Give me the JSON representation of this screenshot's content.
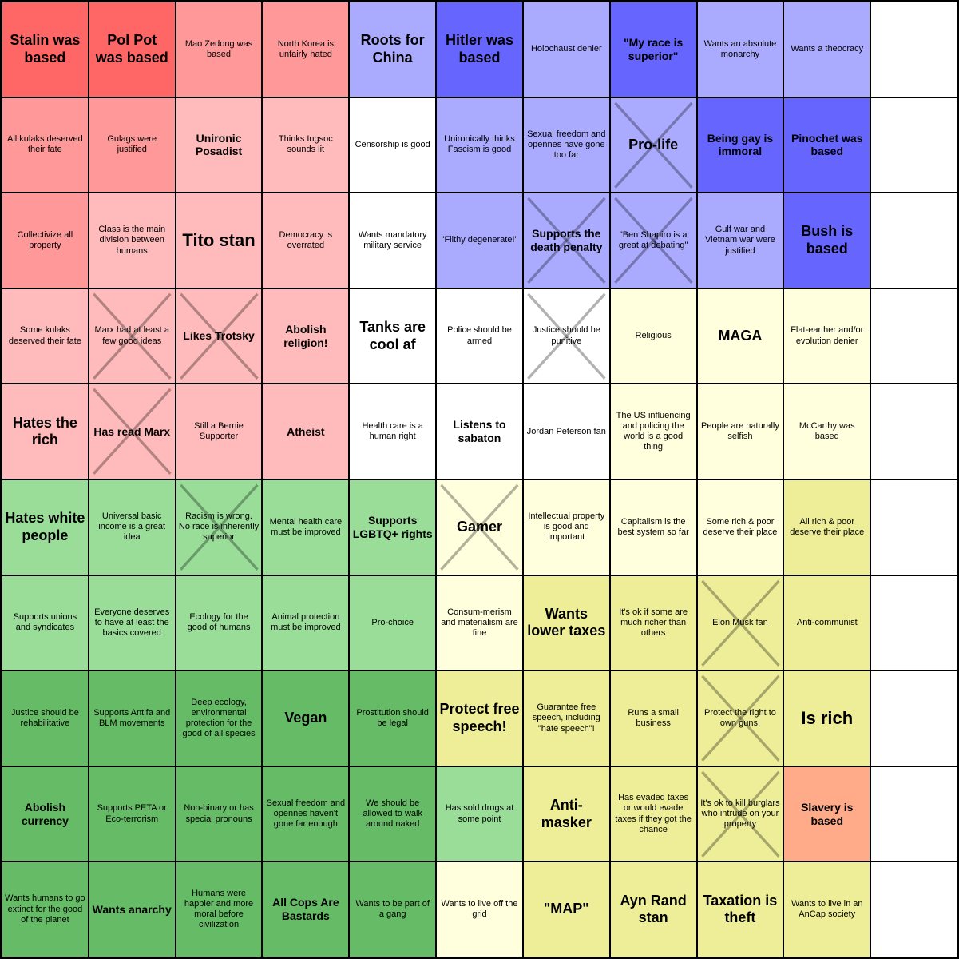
{
  "cells": [
    {
      "text": "Stalin was based",
      "color": "red",
      "size": "large",
      "x": false,
      "col": 1,
      "row": 1
    },
    {
      "text": "Pol Pot was based",
      "color": "red",
      "size": "large",
      "x": false,
      "col": 2,
      "row": 1
    },
    {
      "text": "Mao Zedong was based",
      "color": "pink",
      "size": "small",
      "x": false,
      "col": 3,
      "row": 1
    },
    {
      "text": "North Korea is unfairly hated",
      "color": "pink",
      "size": "small",
      "x": false,
      "col": 4,
      "row": 1
    },
    {
      "text": "Roots for China",
      "color": "light-blue",
      "size": "large",
      "x": false,
      "col": 5,
      "row": 1
    },
    {
      "text": "Hitler was based",
      "color": "blue",
      "size": "large",
      "x": false,
      "col": 6,
      "row": 1
    },
    {
      "text": "Holochaust denier",
      "color": "light-blue",
      "size": "small",
      "x": false,
      "col": 7,
      "row": 1
    },
    {
      "text": "\"My race is superior\"",
      "color": "blue",
      "size": "medium",
      "x": false,
      "col": 8,
      "row": 1
    },
    {
      "text": "Wants an absolute monarchy",
      "color": "light-blue",
      "size": "small",
      "x": false,
      "col": 9,
      "row": 1
    },
    {
      "text": "Wants a theocracy",
      "color": "light-blue",
      "size": "small",
      "x": false,
      "col": 10,
      "row": 1
    },
    {
      "text": "",
      "color": "white",
      "size": "small",
      "x": false,
      "col": 11,
      "row": 1
    },
    {
      "text": "All kulaks deserved their fate",
      "color": "pink",
      "size": "small",
      "x": false,
      "col": 1,
      "row": 2
    },
    {
      "text": "Gulags were justified",
      "color": "pink",
      "size": "small",
      "x": false,
      "col": 2,
      "row": 2
    },
    {
      "text": "Unironic Posadist",
      "color": "light-pink",
      "size": "medium",
      "x": false,
      "col": 3,
      "row": 2
    },
    {
      "text": "Thinks Ingsoc sounds lit",
      "color": "light-pink",
      "size": "small",
      "x": false,
      "col": 4,
      "row": 2
    },
    {
      "text": "Censorship is good",
      "color": "white",
      "size": "small",
      "x": false,
      "col": 5,
      "row": 2
    },
    {
      "text": "Unironically thinks Fascism is good",
      "color": "light-blue",
      "size": "small",
      "x": false,
      "col": 6,
      "row": 2
    },
    {
      "text": "Sexual freedom and opennes have gone too far",
      "color": "light-blue",
      "size": "small",
      "x": false,
      "col": 7,
      "row": 2
    },
    {
      "text": "Pro-life",
      "color": "light-blue",
      "size": "large",
      "x": true,
      "col": 8,
      "row": 2
    },
    {
      "text": "Being gay is immoral",
      "color": "blue",
      "size": "medium",
      "x": false,
      "col": 9,
      "row": 2
    },
    {
      "text": "Pinochet was based",
      "color": "blue",
      "size": "medium",
      "x": false,
      "col": 10,
      "row": 2
    },
    {
      "text": "",
      "color": "white",
      "size": "small",
      "x": false,
      "col": 11,
      "row": 2
    },
    {
      "text": "Collectivize all property",
      "color": "pink",
      "size": "small",
      "x": false,
      "col": 1,
      "row": 3
    },
    {
      "text": "Class is the main division between humans",
      "color": "light-pink",
      "size": "small",
      "x": false,
      "col": 2,
      "row": 3
    },
    {
      "text": "Tito stan",
      "color": "light-pink",
      "size": "xl",
      "x": false,
      "col": 3,
      "row": 3
    },
    {
      "text": "Democracy is overrated",
      "color": "light-pink",
      "size": "small",
      "x": false,
      "col": 4,
      "row": 3
    },
    {
      "text": "Wants mandatory military service",
      "color": "white",
      "size": "small",
      "x": false,
      "col": 5,
      "row": 3
    },
    {
      "text": "\"Filthy degenerate!\"",
      "color": "light-blue",
      "size": "small",
      "x": false,
      "col": 6,
      "row": 3
    },
    {
      "text": "Supports the death penalty",
      "color": "light-blue",
      "size": "medium",
      "x": true,
      "col": 7,
      "row": 3
    },
    {
      "text": "\"Ben Shapiro is a great at debating\"",
      "color": "light-blue",
      "size": "small",
      "x": true,
      "col": 8,
      "row": 3
    },
    {
      "text": "Gulf war and Vietnam war were justified",
      "color": "light-blue",
      "size": "small",
      "x": false,
      "col": 9,
      "row": 3
    },
    {
      "text": "Bush is based",
      "color": "blue",
      "size": "large",
      "x": false,
      "col": 10,
      "row": 3
    },
    {
      "text": "",
      "color": "white",
      "size": "small",
      "x": false,
      "col": 11,
      "row": 3
    },
    {
      "text": "Some kulaks deserved their fate",
      "color": "light-pink",
      "size": "small",
      "x": false,
      "col": 1,
      "row": 4
    },
    {
      "text": "Marx had at least a few good ideas",
      "color": "light-pink",
      "size": "small",
      "x": true,
      "col": 2,
      "row": 4
    },
    {
      "text": "Likes Trotsky",
      "color": "light-pink",
      "size": "medium",
      "x": true,
      "col": 3,
      "row": 4
    },
    {
      "text": "Abolish religion!",
      "color": "light-pink",
      "size": "medium",
      "x": false,
      "col": 4,
      "row": 4
    },
    {
      "text": "Tanks are cool af",
      "color": "white",
      "size": "large",
      "x": false,
      "col": 5,
      "row": 4
    },
    {
      "text": "Police should be armed",
      "color": "white",
      "size": "small",
      "x": false,
      "col": 6,
      "row": 4
    },
    {
      "text": "Justice should be punitive",
      "color": "white",
      "size": "small",
      "x": true,
      "col": 7,
      "row": 4
    },
    {
      "text": "Religious",
      "color": "light-yellow",
      "size": "small",
      "x": false,
      "col": 8,
      "row": 4
    },
    {
      "text": "MAGA",
      "color": "light-yellow",
      "size": "large",
      "x": false,
      "col": 9,
      "row": 4
    },
    {
      "text": "Flat-earther and/or evolution denier",
      "color": "light-yellow",
      "size": "small",
      "x": false,
      "col": 10,
      "row": 4
    },
    {
      "text": "",
      "color": "white",
      "size": "small",
      "x": false,
      "col": 11,
      "row": 4
    },
    {
      "text": "Hates the rich",
      "color": "light-pink",
      "size": "large",
      "x": false,
      "col": 1,
      "row": 5
    },
    {
      "text": "Has read Marx",
      "color": "light-pink",
      "size": "medium",
      "x": true,
      "col": 2,
      "row": 5
    },
    {
      "text": "Still a Bernie Supporter",
      "color": "light-pink",
      "size": "small",
      "x": false,
      "col": 3,
      "row": 5
    },
    {
      "text": "Atheist",
      "color": "light-pink",
      "size": "medium",
      "x": false,
      "col": 4,
      "row": 5
    },
    {
      "text": "Health care is a human right",
      "color": "white",
      "size": "small",
      "x": false,
      "col": 5,
      "row": 5
    },
    {
      "text": "Listens to sabaton",
      "color": "white",
      "size": "medium",
      "x": false,
      "col": 6,
      "row": 5
    },
    {
      "text": "Jordan Peterson fan",
      "color": "white",
      "size": "small",
      "x": false,
      "col": 7,
      "row": 5
    },
    {
      "text": "The US influencing and policing the world is a good thing",
      "color": "light-yellow",
      "size": "small",
      "x": false,
      "col": 8,
      "row": 5
    },
    {
      "text": "People are naturally selfish",
      "color": "light-yellow",
      "size": "small",
      "x": false,
      "col": 9,
      "row": 5
    },
    {
      "text": "McCarthy was based",
      "color": "light-yellow",
      "size": "small",
      "x": false,
      "col": 10,
      "row": 5
    },
    {
      "text": "",
      "color": "white",
      "size": "small",
      "x": false,
      "col": 11,
      "row": 5
    },
    {
      "text": "Hates white people",
      "color": "light-green",
      "size": "large",
      "x": false,
      "col": 1,
      "row": 6
    },
    {
      "text": "Universal basic income is a great idea",
      "color": "light-green",
      "size": "small",
      "x": false,
      "col": 2,
      "row": 6
    },
    {
      "text": "Racism is wrong. No race is inherently superior",
      "color": "light-green",
      "size": "small",
      "x": true,
      "col": 3,
      "row": 6
    },
    {
      "text": "Mental health care must be improved",
      "color": "light-green",
      "size": "small",
      "x": false,
      "col": 4,
      "row": 6
    },
    {
      "text": "Supports LGBTQ+ rights",
      "color": "light-green",
      "size": "medium",
      "x": false,
      "col": 5,
      "row": 6
    },
    {
      "text": "Gamer",
      "color": "light-yellow",
      "size": "large",
      "x": true,
      "col": 6,
      "row": 6
    },
    {
      "text": "Intellectual property is good and important",
      "color": "light-yellow",
      "size": "small",
      "x": false,
      "col": 7,
      "row": 6
    },
    {
      "text": "Capitalism is the best system so far",
      "color": "light-yellow",
      "size": "small",
      "x": false,
      "col": 8,
      "row": 6
    },
    {
      "text": "Some rich & poor deserve their place",
      "color": "light-yellow",
      "size": "small",
      "x": false,
      "col": 9,
      "row": 6
    },
    {
      "text": "All rich & poor deserve their place",
      "color": "yellow",
      "size": "small",
      "x": false,
      "col": 10,
      "row": 6
    },
    {
      "text": "",
      "color": "white",
      "size": "small",
      "x": false,
      "col": 11,
      "row": 6
    },
    {
      "text": "Supports unions and syndicates",
      "color": "light-green",
      "size": "small",
      "x": false,
      "col": 1,
      "row": 7
    },
    {
      "text": "Everyone deserves to have at least the basics covered",
      "color": "light-green",
      "size": "small",
      "x": false,
      "col": 2,
      "row": 7
    },
    {
      "text": "Ecology for the good of humans",
      "color": "light-green",
      "size": "small",
      "x": false,
      "col": 3,
      "row": 7
    },
    {
      "text": "Animal protection must be improved",
      "color": "light-green",
      "size": "small",
      "x": false,
      "col": 4,
      "row": 7
    },
    {
      "text": "Pro-choice",
      "color": "light-green",
      "size": "small",
      "x": false,
      "col": 5,
      "row": 7
    },
    {
      "text": "Consum-merism and materialism are fine",
      "color": "light-yellow",
      "size": "small",
      "x": false,
      "col": 6,
      "row": 7
    },
    {
      "text": "Wants lower taxes",
      "color": "yellow",
      "size": "large",
      "x": false,
      "col": 7,
      "row": 7
    },
    {
      "text": "It's ok if some are much richer than others",
      "color": "yellow",
      "size": "small",
      "x": false,
      "col": 8,
      "row": 7
    },
    {
      "text": "Elon Musk fan",
      "color": "yellow",
      "size": "small",
      "x": true,
      "col": 9,
      "row": 7
    },
    {
      "text": "Anti-communist",
      "color": "yellow",
      "size": "small",
      "x": false,
      "col": 10,
      "row": 7
    },
    {
      "text": "",
      "color": "white",
      "size": "small",
      "x": false,
      "col": 11,
      "row": 7
    },
    {
      "text": "Justice should be rehabilitative",
      "color": "green",
      "size": "small",
      "x": false,
      "col": 1,
      "row": 8
    },
    {
      "text": "Supports Antifa and BLM movements",
      "color": "green",
      "size": "small",
      "x": false,
      "col": 2,
      "row": 8
    },
    {
      "text": "Deep ecology, environmental protection for the good of all species",
      "color": "green",
      "size": "small",
      "x": false,
      "col": 3,
      "row": 8
    },
    {
      "text": "Vegan",
      "color": "green",
      "size": "large",
      "x": false,
      "col": 4,
      "row": 8
    },
    {
      "text": "Prostitution should be legal",
      "color": "green",
      "size": "small",
      "x": false,
      "col": 5,
      "row": 8
    },
    {
      "text": "Protect free speech!",
      "color": "yellow",
      "size": "large",
      "x": false,
      "col": 6,
      "row": 8
    },
    {
      "text": "Guarantee free speech, including \"hate speech\"!",
      "color": "yellow",
      "size": "small",
      "x": false,
      "col": 7,
      "row": 8
    },
    {
      "text": "Runs a small business",
      "color": "yellow",
      "size": "small",
      "x": false,
      "col": 8,
      "row": 8
    },
    {
      "text": "Protect the right to own guns!",
      "color": "yellow",
      "size": "small",
      "x": true,
      "col": 9,
      "row": 8
    },
    {
      "text": "Is rich",
      "color": "yellow",
      "size": "xl",
      "x": false,
      "col": 10,
      "row": 8
    },
    {
      "text": "",
      "color": "white",
      "size": "small",
      "x": false,
      "col": 11,
      "row": 8
    },
    {
      "text": "Abolish currency",
      "color": "green",
      "size": "medium",
      "x": false,
      "col": 1,
      "row": 9
    },
    {
      "text": "Supports PETA or Eco-terrorism",
      "color": "green",
      "size": "small",
      "x": false,
      "col": 2,
      "row": 9
    },
    {
      "text": "Non-binary or has special pronouns",
      "color": "green",
      "size": "small",
      "x": false,
      "col": 3,
      "row": 9
    },
    {
      "text": "Sexual freedom and opennes haven't gone far enough",
      "color": "green",
      "size": "small",
      "x": false,
      "col": 4,
      "row": 9
    },
    {
      "text": "We should be allowed to walk around naked",
      "color": "green",
      "size": "small",
      "x": false,
      "col": 5,
      "row": 9
    },
    {
      "text": "Has sold drugs at some point",
      "color": "light-green",
      "size": "small",
      "x": false,
      "col": 6,
      "row": 9
    },
    {
      "text": "Anti-masker",
      "color": "yellow",
      "size": "large",
      "x": false,
      "col": 7,
      "row": 9
    },
    {
      "text": "Has evaded taxes or would evade taxes if they got the chance",
      "color": "yellow",
      "size": "small",
      "x": false,
      "col": 8,
      "row": 9
    },
    {
      "text": "It's ok to kill burglars who intrude on your property",
      "color": "yellow",
      "size": "small",
      "x": true,
      "col": 9,
      "row": 9
    },
    {
      "text": "Slavery is based",
      "color": "orange",
      "size": "medium",
      "x": false,
      "col": 10,
      "row": 9
    },
    {
      "text": "",
      "color": "white",
      "size": "small",
      "x": false,
      "col": 11,
      "row": 9
    },
    {
      "text": "Wants humans to go extinct for the good of the planet",
      "color": "green",
      "size": "small",
      "x": false,
      "col": 1,
      "row": 10
    },
    {
      "text": "Wants anarchy",
      "color": "green",
      "size": "medium",
      "x": false,
      "col": 2,
      "row": 10
    },
    {
      "text": "Humans were happier and more moral before civilization",
      "color": "green",
      "size": "small",
      "x": false,
      "col": 3,
      "row": 10
    },
    {
      "text": "All Cops Are Bastards",
      "color": "green",
      "size": "medium",
      "x": false,
      "col": 4,
      "row": 10
    },
    {
      "text": "Wants to be part of a gang",
      "color": "green",
      "size": "small",
      "x": false,
      "col": 5,
      "row": 10
    },
    {
      "text": "Wants to live off the grid",
      "color": "light-yellow",
      "size": "small",
      "x": false,
      "col": 6,
      "row": 10
    },
    {
      "text": "\"MAP\"",
      "color": "yellow",
      "size": "large",
      "x": false,
      "col": 7,
      "row": 10
    },
    {
      "text": "Ayn Rand stan",
      "color": "yellow",
      "size": "large",
      "x": false,
      "col": 8,
      "row": 10
    },
    {
      "text": "Taxation is theft",
      "color": "yellow",
      "size": "large",
      "x": false,
      "col": 9,
      "row": 10
    },
    {
      "text": "Wants to live in an AnCap society",
      "color": "yellow",
      "size": "small",
      "x": false,
      "col": 10,
      "row": 10
    },
    {
      "text": "",
      "color": "white",
      "size": "small",
      "x": false,
      "col": 11,
      "row": 10
    }
  ]
}
